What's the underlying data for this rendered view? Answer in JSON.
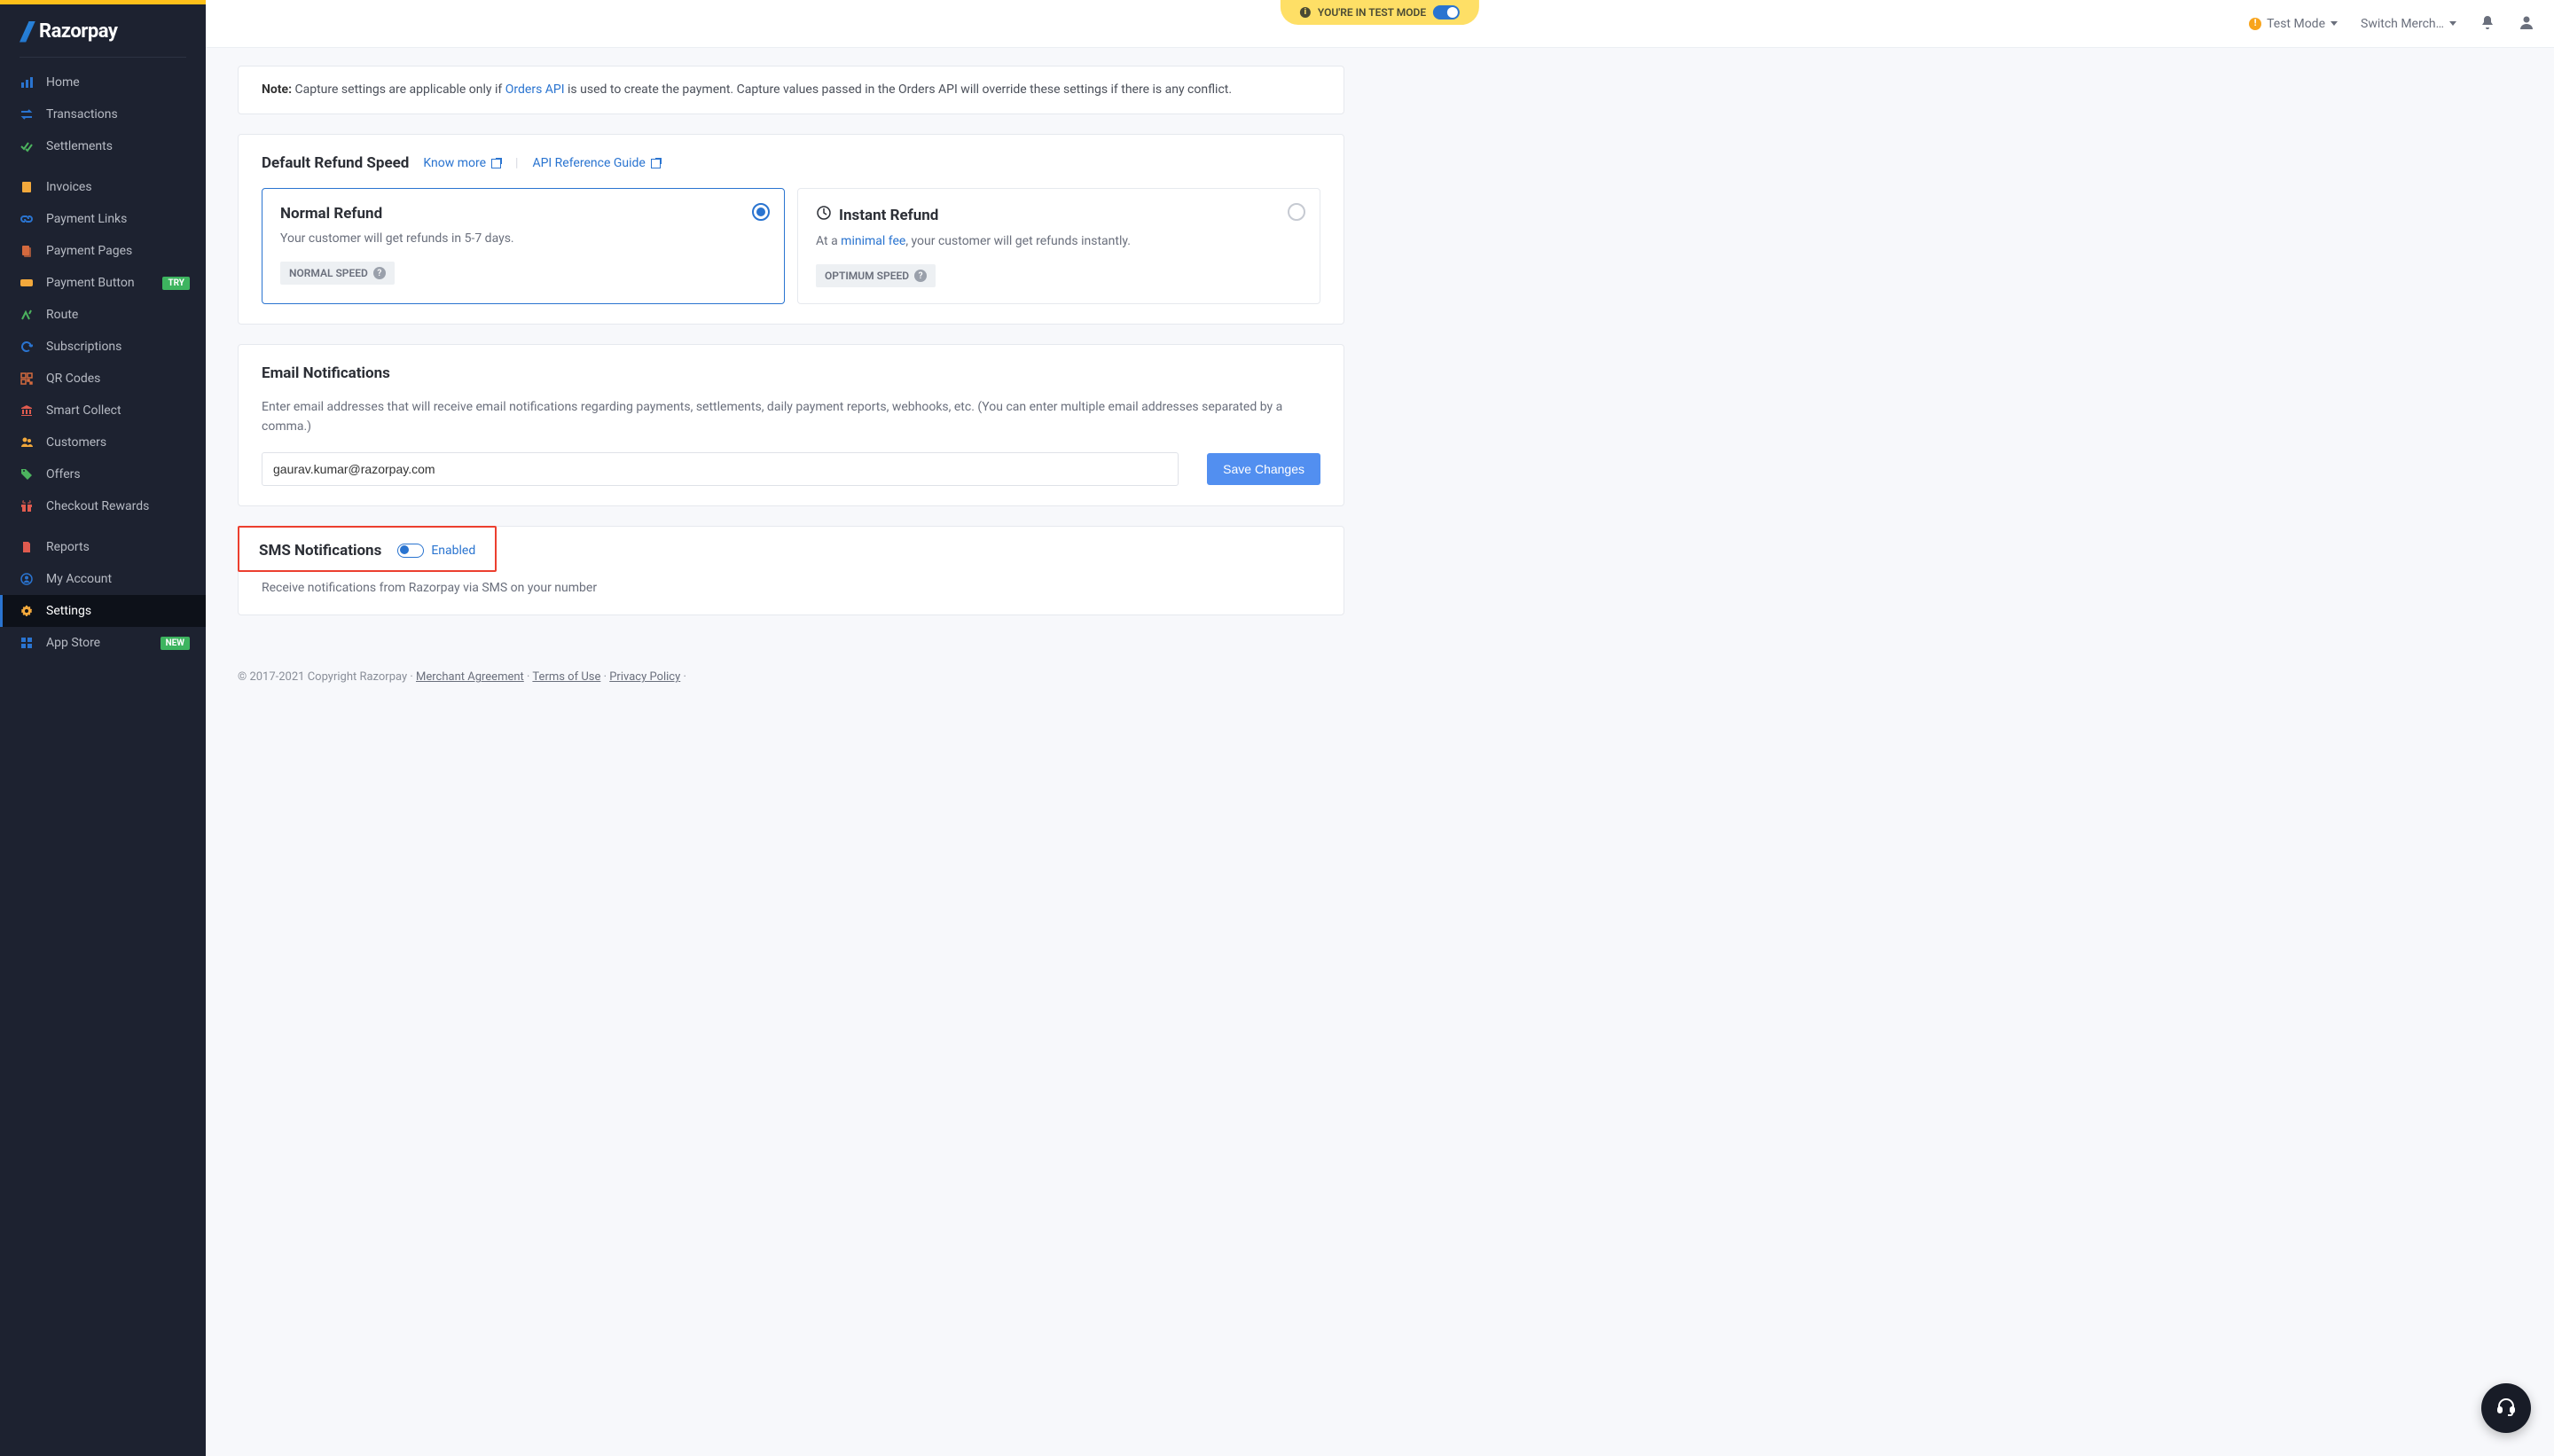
{
  "brand": "Razorpay",
  "banner": {
    "text": "YOU'RE IN TEST MODE"
  },
  "topbar": {
    "testMode": "Test Mode",
    "switchMerchant": "Switch Merch…"
  },
  "sidebar": {
    "items": [
      {
        "label": "Home",
        "icon": "bar-chart"
      },
      {
        "label": "Transactions",
        "icon": "swap"
      },
      {
        "label": "Settlements",
        "icon": "checks"
      },
      {
        "label": "Invoices",
        "icon": "clipboard"
      },
      {
        "label": "Payment Links",
        "icon": "link"
      },
      {
        "label": "Payment Pages",
        "icon": "pages"
      },
      {
        "label": "Payment Button",
        "icon": "button",
        "badge": "TRY"
      },
      {
        "label": "Route",
        "icon": "route"
      },
      {
        "label": "Subscriptions",
        "icon": "refresh"
      },
      {
        "label": "QR Codes",
        "icon": "qr"
      },
      {
        "label": "Smart Collect",
        "icon": "bank"
      },
      {
        "label": "Customers",
        "icon": "users"
      },
      {
        "label": "Offers",
        "icon": "tag"
      },
      {
        "label": "Checkout Rewards",
        "icon": "gift"
      },
      {
        "label": "Reports",
        "icon": "file"
      },
      {
        "label": "My Account",
        "icon": "user-circle"
      },
      {
        "label": "Settings",
        "icon": "gear",
        "active": true
      },
      {
        "label": "App Store",
        "icon": "apps",
        "badge": "NEW"
      }
    ]
  },
  "capture_note": {
    "prefix": "Note:",
    "before": "Capture settings are applicable only if ",
    "link": "Orders API",
    "after": "  is used to create the payment. Capture values passed in the Orders API will override these settings if there is any conflict."
  },
  "refund": {
    "title": "Default Refund Speed",
    "knowMore": "Know more",
    "apiRef": "API Reference Guide",
    "normal": {
      "title": "Normal Refund",
      "desc": "Your customer will get refunds in 5-7 days.",
      "chip": "NORMAL SPEED"
    },
    "instant": {
      "title": "Instant Refund",
      "desc_a": "At a ",
      "desc_link": "minimal fee",
      "desc_b": ", your customer will get refunds instantly.",
      "chip": "OPTIMUM SPEED"
    }
  },
  "email": {
    "title": "Email Notifications",
    "desc": "Enter email addresses that will receive email notifications regarding payments, settlements, daily payment reports, webhooks, etc. (You can enter multiple email addresses separated by a comma.)",
    "value": "gaurav.kumar@razorpay.com",
    "saveLabel": "Save Changes"
  },
  "sms": {
    "title": "SMS Notifications",
    "enabledLabel": "Enabled",
    "desc": "Receive notifications from Razorpay via SMS on your number"
  },
  "footer": {
    "copyright": "© 2017-2021 Copyright Razorpay",
    "merchant": "Merchant Agreement",
    "terms": "Terms of Use",
    "privacy": "Privacy Policy"
  }
}
